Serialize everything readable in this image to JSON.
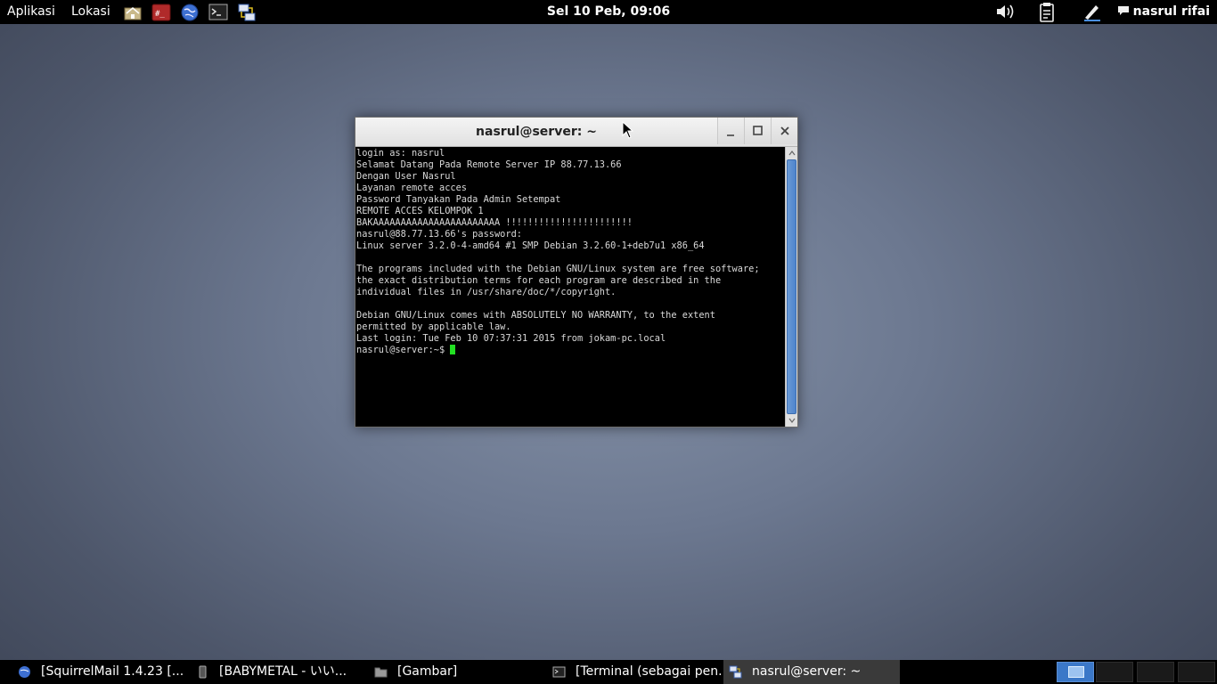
{
  "top_panel": {
    "applications_label": "Aplikasi",
    "places_label": "Lokasi",
    "clock": "Sel 10 Peb, 09:06",
    "user_name": "nasrul rifai",
    "launchers": [
      "home-folder-icon",
      "terminal-red-icon",
      "browser-globe-icon",
      "terminal-icon",
      "network-icon"
    ],
    "tray_icons": [
      "volume-icon",
      "clipboard-icon",
      "pen-icon"
    ]
  },
  "window": {
    "title": "nasrul@server: ~",
    "terminal_lines": [
      "login as: nasrul",
      "Selamat Datang Pada Remote Server IP 88.77.13.66",
      "Dengan User Nasrul",
      "Layanan remote acces",
      "Password Tanyakan Pada Admin Setempat",
      "REMOTE ACCES KELOMPOK 1",
      "BAKAAAAAAAAAAAAAAAAAAAAAAA !!!!!!!!!!!!!!!!!!!!!!!",
      "nasrul@88.77.13.66's password:",
      "Linux server 3.2.0-4-amd64 #1 SMP Debian 3.2.60-1+deb7u1 x86_64",
      "",
      "The programs included with the Debian GNU/Linux system are free software;",
      "the exact distribution terms for each program are described in the",
      "individual files in /usr/share/doc/*/copyright.",
      "",
      "Debian GNU/Linux comes with ABSOLUTELY NO WARRANTY, to the extent",
      "permitted by applicable law.",
      "Last login: Tue Feb 10 07:37:31 2015 from jokam-pc.local"
    ],
    "prompt": "nasrul@server:~$ "
  },
  "taskbar": {
    "tasks": [
      {
        "label": "[SquirrelMail 1.4.23 [...",
        "icon": "browser-icon"
      },
      {
        "label": "[BABYMETAL - いい...",
        "icon": "media-icon"
      },
      {
        "label": "[Gambar]",
        "icon": "folder-icon"
      },
      {
        "label": "[Terminal (sebagai pen...",
        "icon": "terminal-icon"
      },
      {
        "label": "nasrul@server: ~",
        "icon": "putty-icon"
      }
    ],
    "workspaces": 4,
    "active_workspace": 1
  },
  "colors": {
    "desktop_center": "#8592a8",
    "desktop_edge": "#3a4152",
    "panel_bg": "#000000",
    "cursor_green": "#22e022",
    "scroll_blue": "#4e84cc"
  }
}
